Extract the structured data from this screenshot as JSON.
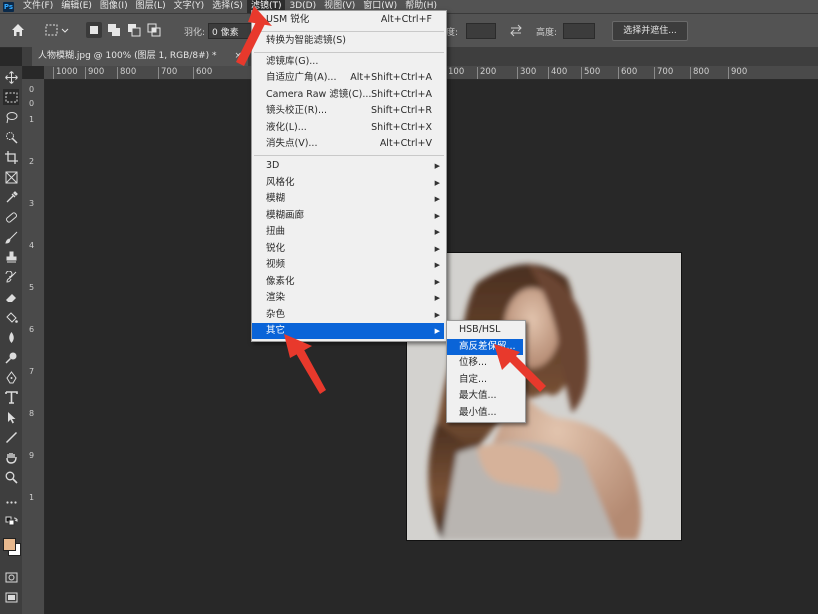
{
  "menubar": {
    "logo": "Ps",
    "items": [
      "文件(F)",
      "编辑(E)",
      "图像(I)",
      "图层(L)",
      "文字(Y)",
      "选择(S)",
      "滤镜(T)",
      "3D(D)",
      "视图(V)",
      "窗口(W)",
      "帮助(H)"
    ],
    "active_item": "滤镜(T)"
  },
  "options_bar": {
    "feather_label": "羽化:",
    "feather_value": "0 像素",
    "width_label": "度:",
    "height_label": "高度:",
    "select_mask_button": "选择并遮住..."
  },
  "document_tab": {
    "title": "人物模糊.jpg @ 100% (图层 1, RGB/8#) *",
    "close": "×"
  },
  "ruler_horizontal": [
    "1000",
    "900",
    "800",
    "700",
    "600",
    "100",
    "200",
    "300",
    "400",
    "500",
    "600",
    "700",
    "800",
    "900"
  ],
  "ruler_vertical": [
    "0",
    "0",
    "1",
    "2",
    "3",
    "4",
    "5",
    "6",
    "7",
    "8",
    "9",
    "1"
  ],
  "filter_menu": {
    "items": [
      {
        "label": "USM 锐化",
        "shortcut": "Alt+Ctrl+F"
      },
      {
        "label": "转换为智能滤镜(S)",
        "shortcut": ""
      },
      {
        "label": "滤镜库(G)...",
        "shortcut": ""
      },
      {
        "label": "自适应广角(A)...",
        "shortcut": "Alt+Shift+Ctrl+A"
      },
      {
        "label": "Camera Raw 滤镜(C)...",
        "shortcut": "Shift+Ctrl+A"
      },
      {
        "label": "镜头校正(R)...",
        "shortcut": "Shift+Ctrl+R"
      },
      {
        "label": "液化(L)...",
        "shortcut": "Shift+Ctrl+X"
      },
      {
        "label": "消失点(V)...",
        "shortcut": "Alt+Ctrl+V"
      },
      {
        "label": "3D"
      },
      {
        "label": "风格化"
      },
      {
        "label": "模糊"
      },
      {
        "label": "模糊画廊"
      },
      {
        "label": "扭曲"
      },
      {
        "label": "锐化"
      },
      {
        "label": "视频"
      },
      {
        "label": "像素化"
      },
      {
        "label": "渲染"
      },
      {
        "label": "杂色"
      },
      {
        "label": "其它"
      }
    ]
  },
  "other_submenu": {
    "items": [
      "HSB/HSL",
      "高反差保留...",
      "位移...",
      "自定...",
      "最大值...",
      "最小值..."
    ],
    "highlighted": "高反差保留..."
  },
  "colors": {
    "menu_highlight": "#0a64d8",
    "annotation_arrow": "#e8392c",
    "foreground_swatch": "#e8b98e",
    "background_swatch": "#ffffff"
  }
}
